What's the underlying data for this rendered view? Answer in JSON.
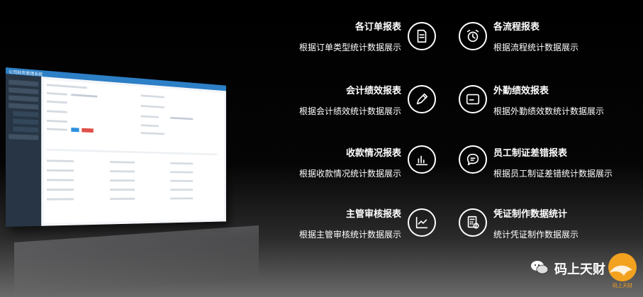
{
  "mock": {
    "title": "公司财务管理系统"
  },
  "features": [
    {
      "title": "各订单报表",
      "desc": "根据订单类型统计数据展示",
      "icon": "document-icon"
    },
    {
      "title": "各流程报表",
      "desc": "根据流程统计数据展示",
      "icon": "alarm-clock-icon"
    },
    {
      "title": "会计绩效报表",
      "desc": "根据会计绩效统计数据展示",
      "icon": "pencil-icon"
    },
    {
      "title": "外勤绩效报表",
      "desc": "根据外勤绩效数统计数据展示",
      "icon": "card-icon"
    },
    {
      "title": "收款情况报表",
      "desc": "根据收款情况统计数据展示",
      "icon": "bar-chart-icon"
    },
    {
      "title": "员工制证差错报表",
      "desc": "根据员工制证差错统计数据展示",
      "icon": "chat-icon"
    },
    {
      "title": "主管审核报表",
      "desc": "根据主管审核统计数据展示",
      "icon": "line-chart-icon"
    },
    {
      "title": "凭证制作数据统计",
      "desc": "统计凭证制作数据展示",
      "icon": "calculator-icon"
    }
  ],
  "brand": {
    "name": "码上天财",
    "logo_text": "码上天财"
  }
}
